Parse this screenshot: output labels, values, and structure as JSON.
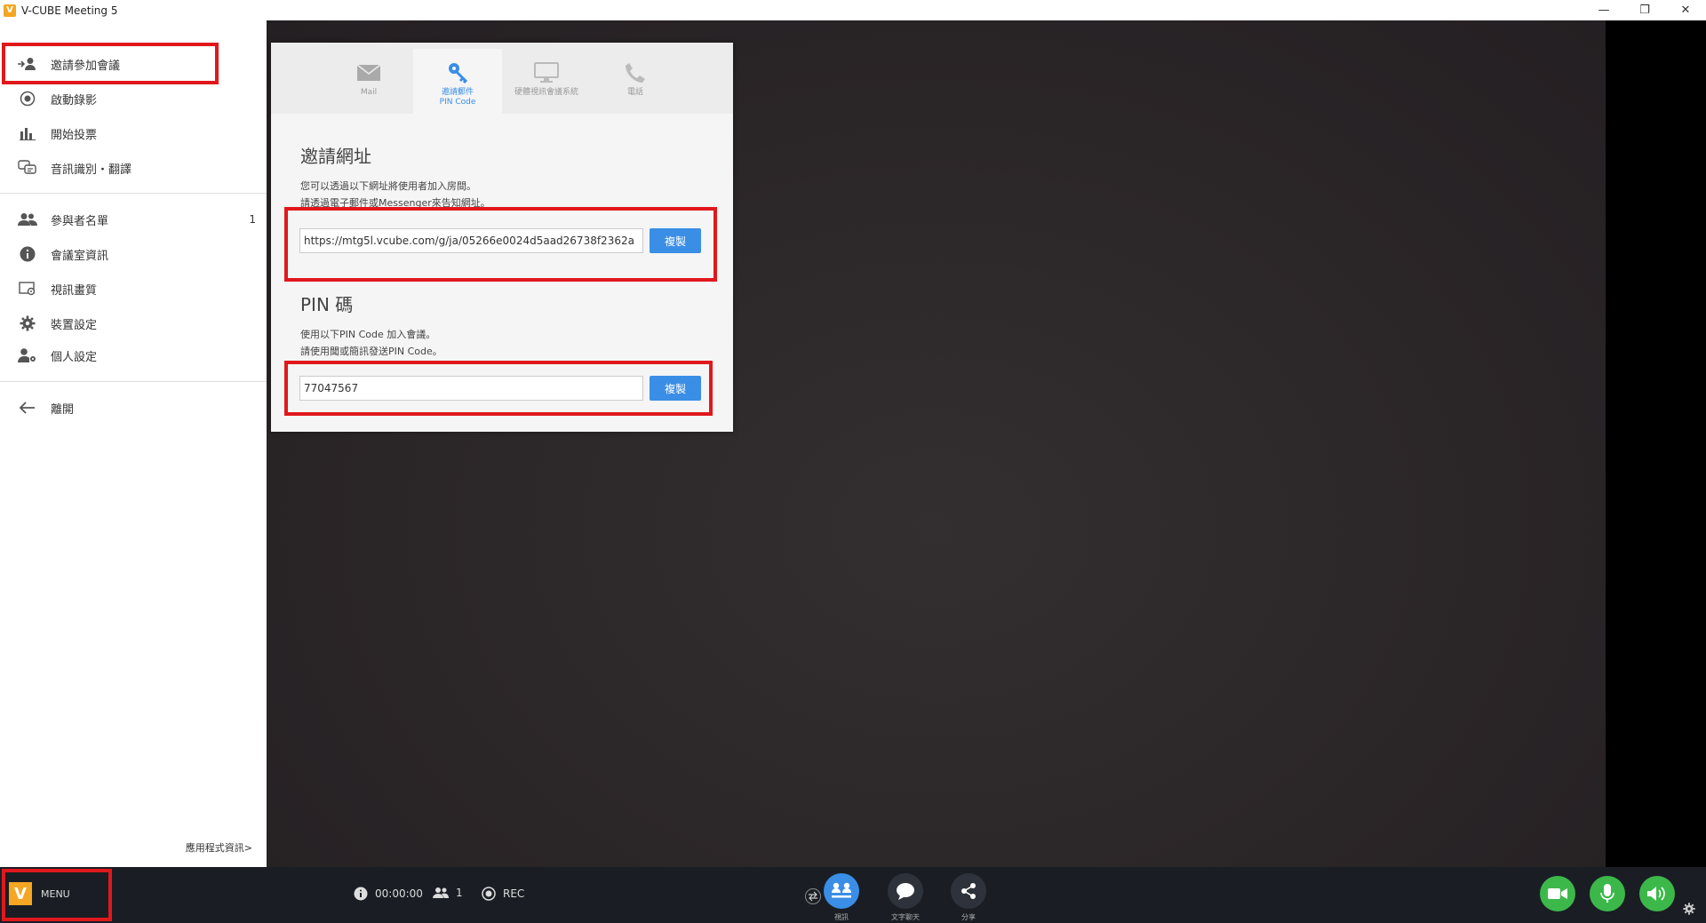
{
  "window": {
    "title": "V-CUBE Meeting 5",
    "minimize": "—",
    "restore": "❐",
    "close": "✕"
  },
  "sidebar": {
    "items": [
      {
        "label": "邀請參加會議"
      },
      {
        "label": "啟動錄影"
      },
      {
        "label": "開始投票"
      },
      {
        "label": "音訊識別・翻譯"
      },
      {
        "label": "參與者名單",
        "count": "1"
      },
      {
        "label": "會議室資訊"
      },
      {
        "label": "視訊畫質"
      },
      {
        "label": "裝置設定"
      },
      {
        "label": "個人設定"
      },
      {
        "label": "離開"
      }
    ],
    "app_info": "應用程式資訊>"
  },
  "invite_panel": {
    "tabs": [
      {
        "label": "Mail"
      },
      {
        "label": "邀請郵件\nPIN Code"
      },
      {
        "label": "硬體視訊會議系統"
      },
      {
        "label": "電話"
      }
    ],
    "url_section": {
      "title": "邀請網址",
      "desc1": "您可以透過以下網址將使用者加入房間。",
      "desc2": "請透過電子郵件或Messenger來告知網址。",
      "url": "https://mtg5l.vcube.com/g/ja/05266e0024d5aad26738f2362a",
      "copy_label": "複製"
    },
    "pin_section": {
      "title": "PIN 碼",
      "desc1": "使用以下PIN Code 加入會議。",
      "desc2": "請使用聞或簡訊發送PIN Code。",
      "pin": "77047567",
      "copy_label": "複製"
    }
  },
  "bottombar": {
    "menu_label": "MENU",
    "timer": "00:00:00",
    "participants": "1",
    "rec_label": "REC",
    "center_buttons": [
      {
        "label": "視訊"
      },
      {
        "label": "文字聊天"
      },
      {
        "label": "分享"
      }
    ]
  },
  "colors": {
    "accent": "#3a8ee6",
    "highlight": "#e0181c",
    "green": "#3cb84a",
    "brand": "#f5a623"
  }
}
